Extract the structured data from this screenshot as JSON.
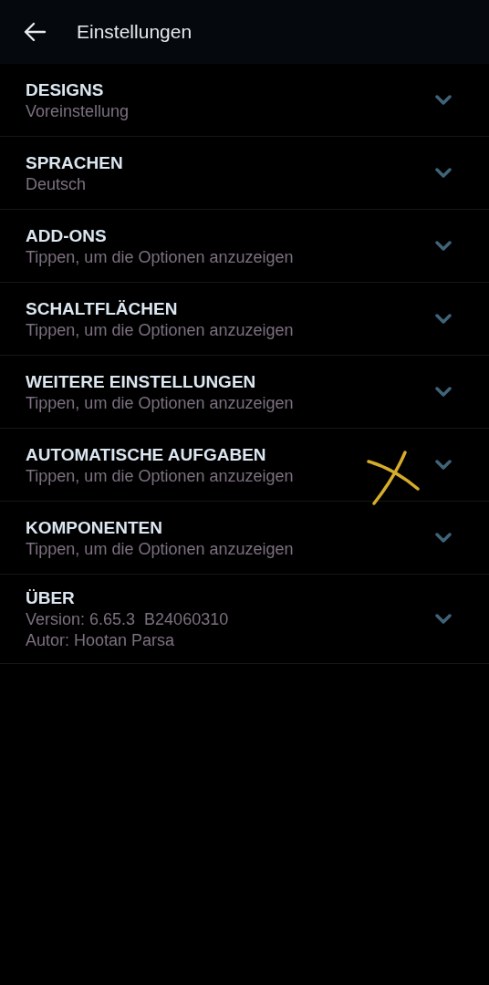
{
  "app_bar": {
    "title": "Einstellungen"
  },
  "sections": [
    {
      "title": "DESIGNS",
      "lines": [
        "Voreinstellung"
      ],
      "expanded": false
    },
    {
      "title": "SPRACHEN",
      "lines": [
        "Deutsch"
      ],
      "expanded": false
    },
    {
      "title": "ADD-ONS",
      "lines": [
        "Tippen, um die Optionen anzuzeigen"
      ],
      "expanded": false
    },
    {
      "title": "SCHALTFLÄCHEN",
      "lines": [
        "Tippen, um die Optionen anzuzeigen"
      ],
      "expanded": false
    },
    {
      "title": "WEITERE EINSTELLUNGEN",
      "lines": [
        "Tippen, um die Optionen anzuzeigen"
      ],
      "expanded": false
    },
    {
      "title": "AUTOMATISCHE AUFGABEN",
      "lines": [
        "Tippen, um die Optionen anzuzeigen"
      ],
      "expanded": false
    },
    {
      "title": "KOMPONENTEN",
      "lines": [
        "Tippen, um die Optionen anzuzeigen"
      ],
      "expanded": false
    },
    {
      "title": "ÜBER",
      "lines": [
        "Version: 6.65.3  B24060310",
        "Autor: Hootan Parsa"
      ],
      "expanded": false
    }
  ]
}
